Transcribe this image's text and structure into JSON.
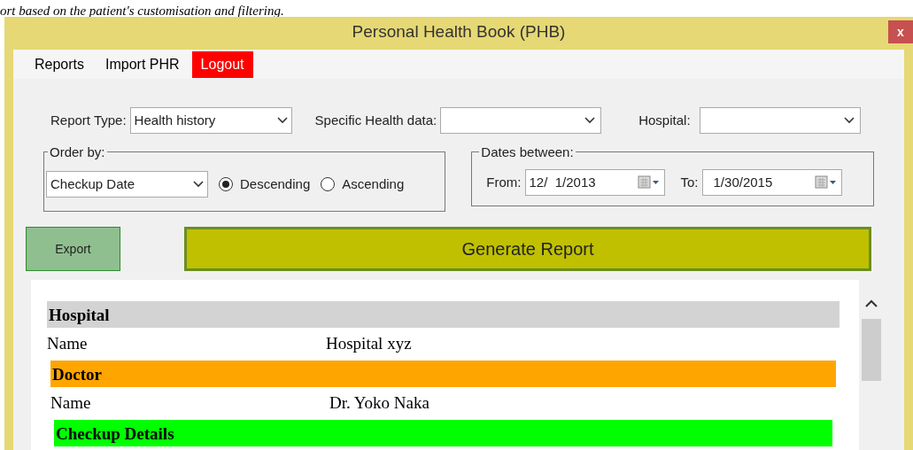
{
  "caption": "ort based on the patient's customisation and filtering.",
  "window": {
    "title": "Personal Health Book (PHB)",
    "close": "x"
  },
  "menu": [
    {
      "label": "Reports",
      "highlighted": false
    },
    {
      "label": "Import PHR",
      "highlighted": false
    },
    {
      "label": "Logout",
      "highlighted": true
    }
  ],
  "filters": [
    {
      "label": "Report Type:",
      "value": "Health history"
    },
    {
      "label": "Specific Health data:"
    },
    {
      "label": "Hospital:"
    }
  ],
  "order_by": {
    "title": "Order by:",
    "value": "Checkup Date",
    "options": [
      {
        "label": "Descending",
        "selected": true
      },
      {
        "label": "Ascending",
        "selected": false
      }
    ]
  },
  "dates": {
    "title": "Dates between:",
    "from_label": "From:",
    "from": "12/  1/2013",
    "to_label": "To:",
    "to": "1/30/2015"
  },
  "buttons": {
    "export": "Export",
    "generate": "Generate Report"
  },
  "report": [
    {
      "title": "Hospital",
      "color": "#d3d3d3",
      "rows": [
        {
          "label": "Name",
          "value": "Hospital xyz"
        }
      ]
    },
    {
      "title": "Doctor",
      "color": "#ffa500",
      "rows": [
        {
          "label": "Name",
          "value": "Dr. Yoko Naka"
        }
      ]
    },
    {
      "title": "Checkup Details",
      "color": "#00ff00"
    }
  ]
}
